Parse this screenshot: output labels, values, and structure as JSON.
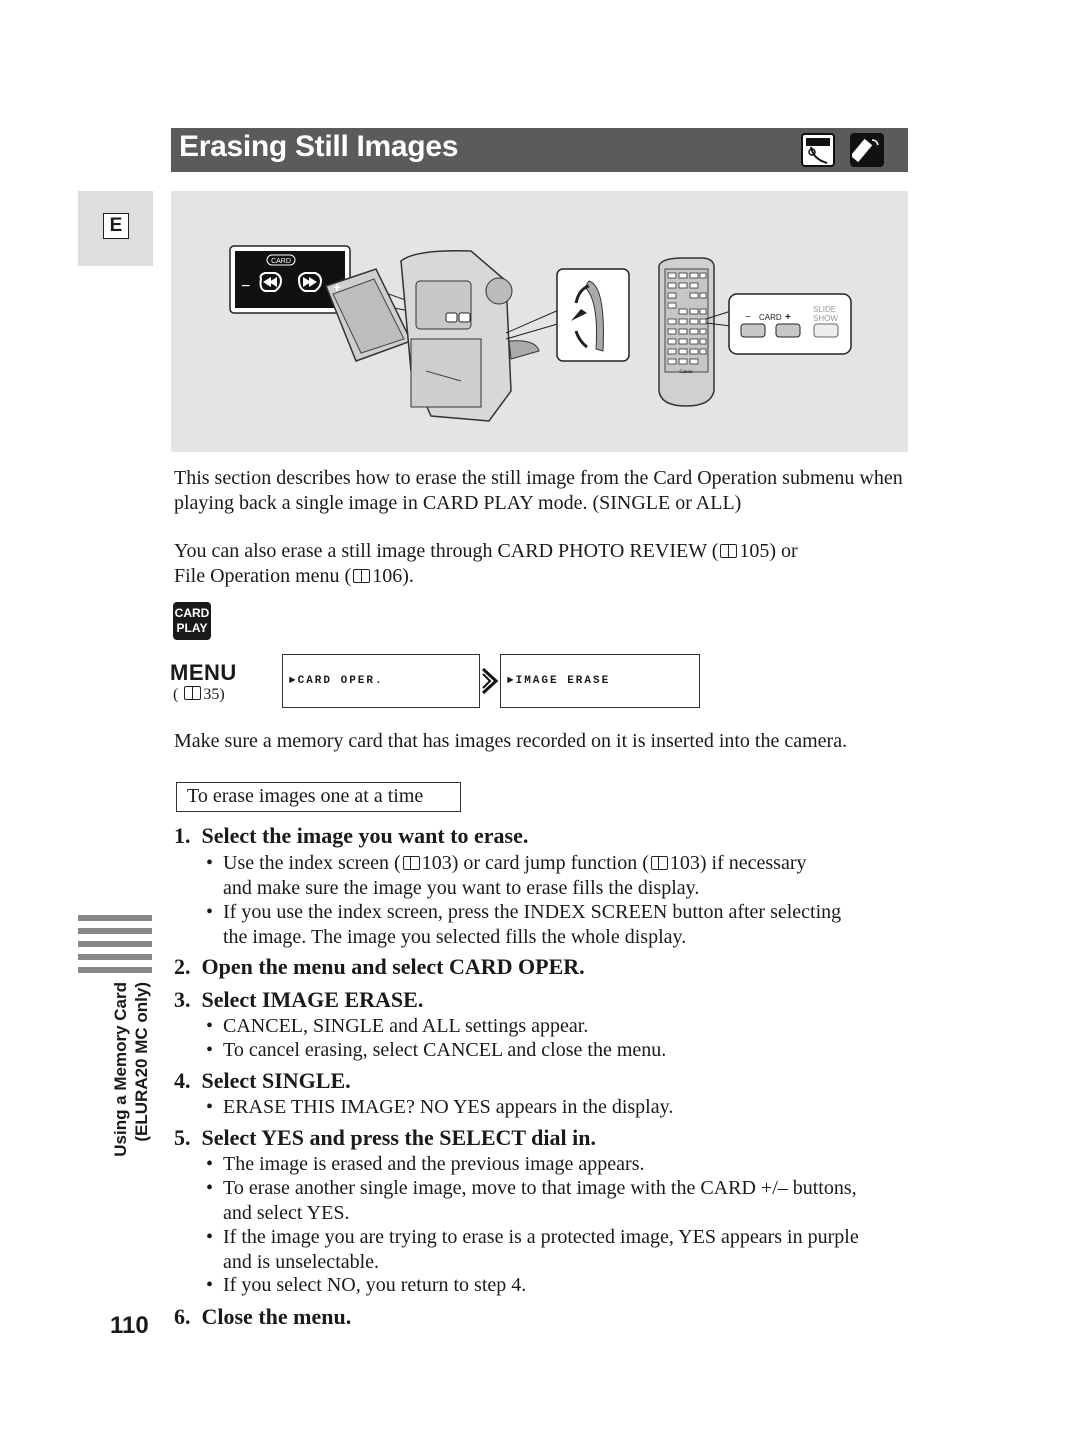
{
  "header": {
    "title": "Erasing Still Images",
    "icons": [
      "camcorder-body-icon",
      "wireless-controller-icon"
    ]
  },
  "language_tab": "E",
  "figure": {
    "camera_callout": {
      "label": "CARD",
      "minus": "−",
      "plus": "+",
      "buttons": [
        "rewind",
        "fast-forward"
      ]
    },
    "remote_callout": {
      "minus": "−",
      "card": "CARD",
      "plus": "+",
      "slide_show": "SLIDE SHOW",
      "brand": "Canon"
    }
  },
  "intro": {
    "p1": "This section describes how to erase the still image from the Card Operation submenu when playing back a single image in CARD PLAY mode. (SINGLE or ALL)",
    "p2_before": "You can also erase a still image through CARD PHOTO REVIEW (",
    "p2_ref1": "105) or",
    "p2_line2_before": "File Operation menu (",
    "p2_ref2": "106)."
  },
  "mode_badge": {
    "line1": "CARD",
    "line2": "PLAY"
  },
  "menu": {
    "label": "MENU",
    "ref": "35)",
    "ref_open": "(",
    "box1": "►CARD OPER.",
    "box2": "►IMAGE ERASE"
  },
  "prereq": "Make sure a memory card that has images recorded on it is inserted into the camera.",
  "section_box": "To erase images one at a time",
  "steps": [
    {
      "num": "1.",
      "title": "Select the image you want to erase.",
      "bullets": [
        "Use the index screen ( 103) or card jump function ( 103) if necessary and make sure the image you want to erase fills the display.",
        "If you use the index screen, press the INDEX SCREEN button after selecting the image. The image you selected fills the whole display."
      ]
    },
    {
      "num": "2.",
      "title": "Open the menu and select CARD OPER.",
      "bullets": []
    },
    {
      "num": "3.",
      "title": "Select IMAGE ERASE.",
      "bullets": [
        "CANCEL, SINGLE and ALL settings appear.",
        "To cancel erasing, select CANCEL and close the menu."
      ]
    },
    {
      "num": "4.",
      "title": "Select SINGLE.",
      "bullets": [
        "ERASE THIS IMAGE? NO YES appears in the display."
      ]
    },
    {
      "num": "5.",
      "title": "Select YES and press the SELECT dial in.",
      "bullets": [
        "The image is erased and the previous image appears.",
        "To erase another single image, move to that image with the CARD +/– buttons, and select YES.",
        "If the image you are trying to erase is a protected image, YES appears in purple and is unselectable.",
        "If you select NO, you return to step 4."
      ]
    },
    {
      "num": "6.",
      "title": "Close the menu.",
      "bullets": []
    }
  ],
  "step1_bullet1": {
    "a": "Use the index screen (",
    "b": "103) or card jump function (",
    "c": "103) if necessary",
    "d": "and make sure the image you want to erase fills the display."
  },
  "sidebar": {
    "line1": "Using a Memory Card",
    "line2": "(ELURA20 MC only)"
  },
  "page_number": "110",
  "colors": {
    "title_bar": "#5b5b5b",
    "figure_bg": "#e4e4e4",
    "tab_bg": "#dedede",
    "side_bars": "#888888"
  }
}
